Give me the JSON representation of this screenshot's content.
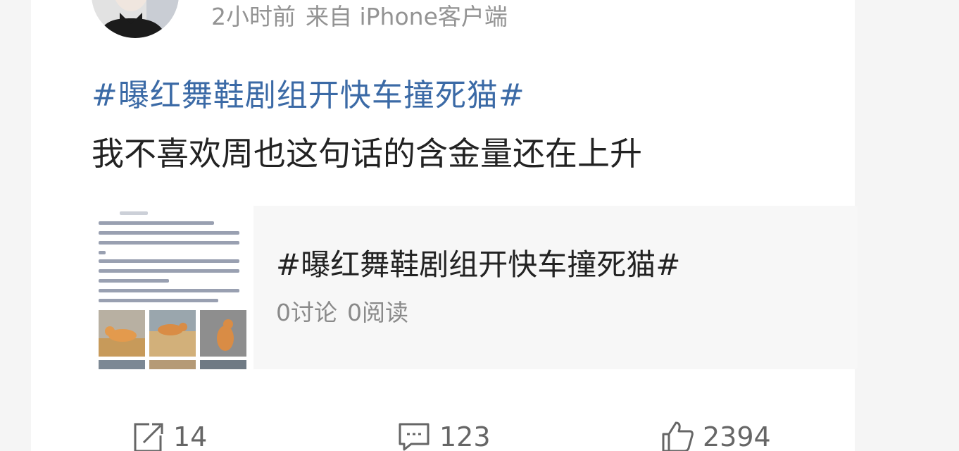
{
  "post": {
    "timestamp": "2小时前",
    "source": "来自 iPhone客户端",
    "topic": "#曝红舞鞋剧组开快车撞死猫#",
    "text": "我不喜欢周也这句话的含金量还在上升"
  },
  "topic_card": {
    "title": "#曝红舞鞋剧组开快车撞死猫#",
    "discussions": "0讨论",
    "reads": "0阅读"
  },
  "actions": {
    "repost": {
      "icon": "repost-icon",
      "count": "14"
    },
    "comment": {
      "icon": "comment-icon",
      "count": "123"
    },
    "like": {
      "icon": "like-icon",
      "count": "2394"
    }
  },
  "colors": {
    "topic_link": "#3b6aa6",
    "text": "#222222",
    "meta": "#939393"
  }
}
